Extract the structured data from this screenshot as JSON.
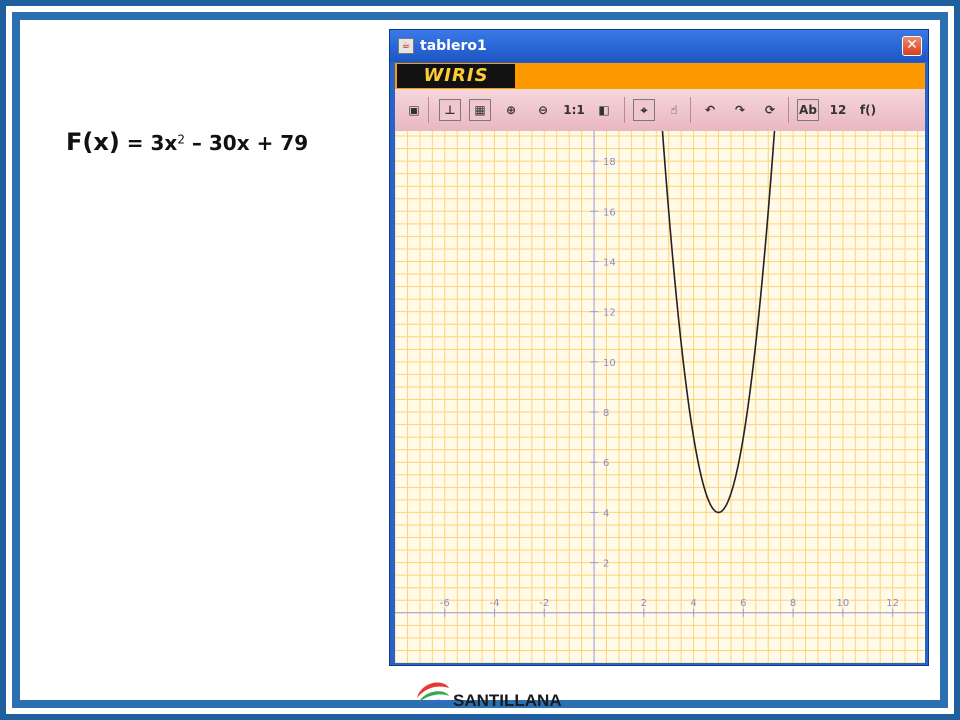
{
  "slide": {
    "formula_lhs": "F(x)",
    "formula_rhs_prefix": " = 3x",
    "formula_exponent": "2",
    "formula_rhs_suffix": " – 30x + 79"
  },
  "window": {
    "title": "tablero1",
    "close_label": "✕",
    "brand": "WIRIS"
  },
  "toolbar": {
    "items": [
      {
        "name": "save-icon",
        "label": "▣"
      },
      {
        "name": "axes-icon",
        "label": "⊥"
      },
      {
        "name": "grid-icon",
        "label": "▦"
      },
      {
        "name": "zoom-in-icon",
        "label": "⊕"
      },
      {
        "name": "zoom-out-icon",
        "label": "⊖"
      },
      {
        "name": "scale-one-to-one-icon",
        "label": "1:1"
      },
      {
        "name": "contrast-icon",
        "label": "◧"
      },
      {
        "name": "target-icon",
        "label": "⌖"
      },
      {
        "name": "hand-pointer-icon",
        "label": "☝"
      },
      {
        "name": "rotate-left-icon",
        "label": "↶"
      },
      {
        "name": "rotate-right-icon",
        "label": "↷"
      },
      {
        "name": "refresh-icon",
        "label": "⟳"
      },
      {
        "name": "text-label-icon",
        "label": "Ab"
      },
      {
        "name": "number-label-icon",
        "label": "12"
      },
      {
        "name": "function-label-icon",
        "label": "f()"
      }
    ]
  },
  "chart_data": {
    "type": "line",
    "function": "3x^2 - 30x + 79",
    "x_ticks": [
      -6,
      -4,
      -2,
      2,
      4,
      6,
      8,
      10,
      12
    ],
    "y_ticks": [
      2,
      4,
      6,
      8,
      10,
      12,
      14,
      16,
      18
    ],
    "xlim": [
      -8,
      13.3
    ],
    "ylim": [
      -2,
      19.2
    ],
    "vertex": [
      5,
      4
    ],
    "grid": true,
    "colors": {
      "grid": "#ffd27a",
      "axis": "#9a9ae0",
      "curve": "#222222",
      "tick_label": "#8a8ad0"
    }
  },
  "footer": {
    "brand": "SANTILLANA"
  }
}
